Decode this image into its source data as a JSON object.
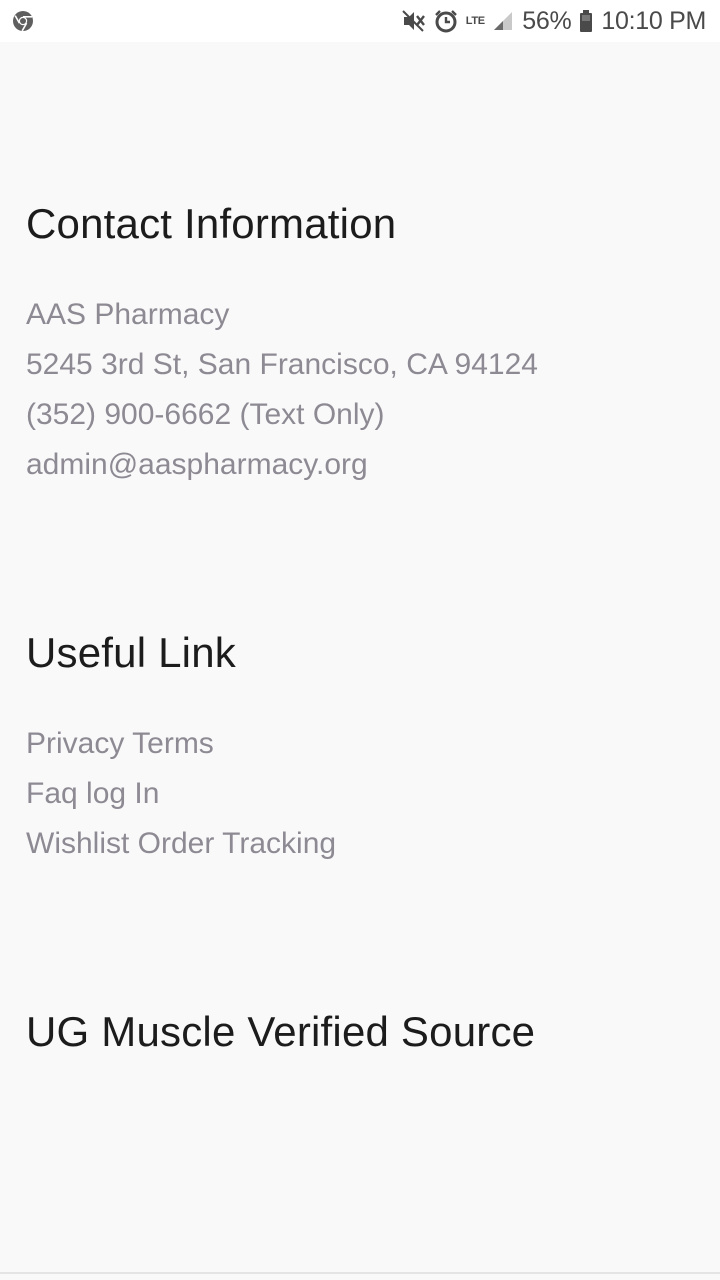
{
  "status_bar": {
    "battery_percent": "56%",
    "time": "10:10 PM",
    "network_label": "LTE",
    "icons": [
      "chrome-icon",
      "mute-icon",
      "alarm-icon",
      "lte-icon",
      "signal-icon",
      "battery-icon"
    ]
  },
  "contact": {
    "title": "Contact Information",
    "lines": [
      "AAS Pharmacy",
      "5245 3rd St, San Francisco, CA 94124",
      "(352) 900-6662 (Text Only)",
      "admin@aaspharmacy.org"
    ]
  },
  "useful": {
    "title": "Useful Link",
    "links": [
      "Privacy Terms",
      "Faq log In",
      "Wishlist Order Tracking"
    ]
  },
  "verified": {
    "title": "UG Muscle Verified Source"
  },
  "colors": {
    "background": "#f9f9f9",
    "heading": "#1c1c1c",
    "body_text": "#8e8a94"
  }
}
